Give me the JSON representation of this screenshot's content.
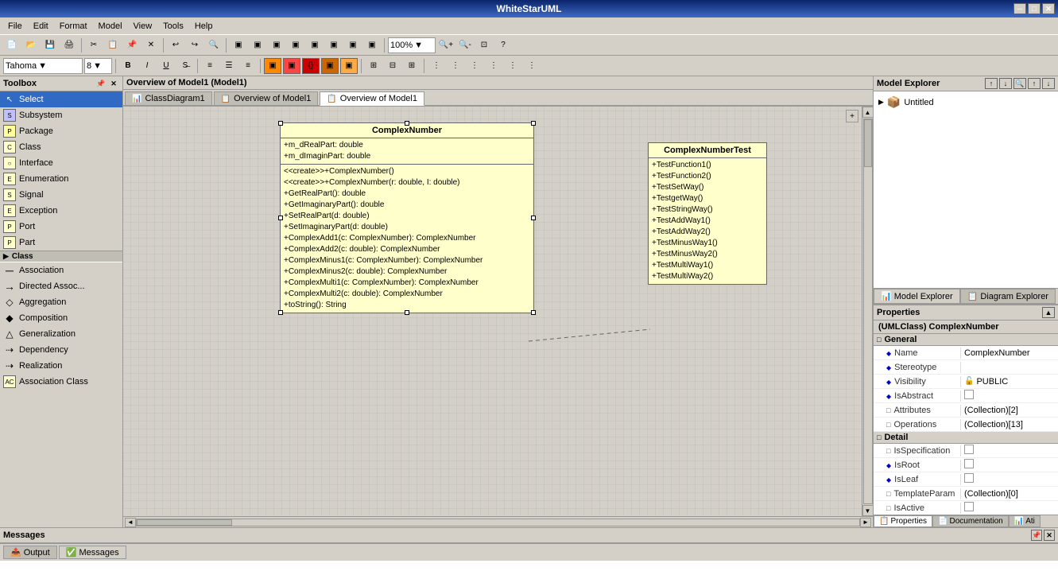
{
  "app": {
    "title": "WhiteStarUML",
    "min_btn": "─",
    "max_btn": "□",
    "close_btn": "✕"
  },
  "menu": {
    "items": [
      "File",
      "Edit",
      "Format",
      "Model",
      "View",
      "Tools",
      "Help"
    ]
  },
  "toolbar1": {
    "zoom_value": "100%",
    "font_name": "Tahoma",
    "font_size": "8"
  },
  "toolbox": {
    "title": "Toolbox",
    "sections": {
      "class_label": "Class"
    },
    "items": [
      {
        "id": "select",
        "label": "Select",
        "icon": "↖"
      },
      {
        "id": "subsystem",
        "label": "Subsystem",
        "icon": "▣"
      },
      {
        "id": "package",
        "label": "Package",
        "icon": "▱"
      },
      {
        "id": "class",
        "label": "Class",
        "icon": "▣"
      },
      {
        "id": "interface",
        "label": "Interface",
        "icon": "◎"
      },
      {
        "id": "enumeration",
        "label": "Enumeration",
        "icon": "▣"
      },
      {
        "id": "signal",
        "label": "Signal",
        "icon": "▣"
      },
      {
        "id": "exception",
        "label": "Exception",
        "icon": "▣"
      },
      {
        "id": "port",
        "label": "Port",
        "icon": "▣"
      },
      {
        "id": "part",
        "label": "Part",
        "icon": "▣"
      },
      {
        "id": "association",
        "label": "Association",
        "icon": "─"
      },
      {
        "id": "directed-assoc",
        "label": "Directed Assoc...",
        "icon": "→"
      },
      {
        "id": "aggregation",
        "label": "Aggregation",
        "icon": "◇"
      },
      {
        "id": "composition",
        "label": "Composition",
        "icon": "◆"
      },
      {
        "id": "generalization",
        "label": "Generalization",
        "icon": "△"
      },
      {
        "id": "dependency",
        "label": "Dependency",
        "icon": "⇢"
      },
      {
        "id": "realization",
        "label": "Realization",
        "icon": "⇢"
      },
      {
        "id": "association-class",
        "label": "Association Class",
        "icon": "▣"
      }
    ]
  },
  "tabs": {
    "items": [
      {
        "id": "class-diagram",
        "label": "ClassDiagram1",
        "icon": "📊",
        "active": false
      },
      {
        "id": "overview-model1-tab",
        "label": "Overview of Model1",
        "icon": "📋",
        "active": false
      },
      {
        "id": "overview-model1",
        "label": "Overview of Model1",
        "icon": "📋",
        "active": true
      }
    ],
    "header": "Overview of Model1 (Model1)"
  },
  "diagram": {
    "complex_number": {
      "title": "ComplexNumber",
      "attributes": [
        "+m_dRealPart: double",
        "+m_dImaginPart: double"
      ],
      "operations": [
        "<<create>>+ComplexNumber()",
        "<<create>>+ComplexNumber(r: double, I: double)",
        "+GetRealPart(): double",
        "+GetImaginaryPart(): double",
        "+SetRealPart(d: double)",
        "+SetImaginaryPart(d: double)",
        "+ComplexAdd1(c: ComplexNumber): ComplexNumber",
        "+ComplexAdd2(c: double): ComplexNumber",
        "+ComplexMinus1(c: ComplexNumber): ComplexNumber",
        "+ComplexMinus2(c: double): ComplexNumber",
        "+ComplexMulti1(c: ComplexNumber): ComplexNumber",
        "+ComplexMulti2(c: double): ComplexNumber",
        "+toString(): String"
      ]
    },
    "complex_number_test": {
      "title": "ComplexNumberTest",
      "operations": [
        "+TestFunction1()",
        "+TestFunction2()",
        "+TestSetWay()",
        "+TestgetWay()",
        "+TestStringWay()",
        "+TestAddWay1()",
        "+TestAddWay2()",
        "+TestMinusWay1()",
        "+TestMinusWay2()",
        "+TestMultiWay1()",
        "+TestMultiWay2()"
      ]
    }
  },
  "model_explorer": {
    "title": "Model Explorer",
    "tabs": [
      {
        "id": "model-explorer-tab",
        "label": "Model Explorer",
        "active": true
      },
      {
        "id": "diagram-explorer-tab",
        "label": "Diagram Explorer",
        "active": false
      }
    ],
    "tree": {
      "root": "Untitled"
    }
  },
  "properties": {
    "title": "Properties",
    "object_title": "(UMLClass) ComplexNumber",
    "sections": {
      "general": "General",
      "detail": "Detail"
    },
    "general_props": [
      {
        "key": "Name",
        "val": "ComplexNumber",
        "type": "diamond"
      },
      {
        "key": "Stereotype",
        "val": "",
        "type": "diamond"
      },
      {
        "key": "Visibility",
        "val": "PUBLIC",
        "type": "diamond",
        "has_icon": true
      },
      {
        "key": "IsAbstract",
        "val": "",
        "type": "diamond",
        "has_checkbox": true
      },
      {
        "key": "Attributes",
        "val": "(Collection)[2]",
        "type": "square"
      },
      {
        "key": "Operations",
        "val": "(Collection)[13]",
        "type": "square"
      }
    ],
    "detail_props": [
      {
        "key": "IsSpecification",
        "val": "",
        "type": "square",
        "has_checkbox": true
      },
      {
        "key": "IsRoot",
        "val": "",
        "type": "diamond",
        "has_checkbox": true
      },
      {
        "key": "IsLeaf",
        "val": "",
        "type": "diamond",
        "has_checkbox": true
      },
      {
        "key": "TemplateParam",
        "val": "(Collection)[0]",
        "type": "square"
      },
      {
        "key": "IsActive",
        "val": "",
        "type": "square",
        "has_checkbox": true
      }
    ],
    "bottom_tabs": [
      {
        "id": "properties-tab",
        "label": "Properties",
        "active": true
      },
      {
        "id": "documentation-tab",
        "label": "Documentation",
        "active": false
      },
      {
        "id": "ati-tab",
        "label": "Ati",
        "active": false
      }
    ]
  },
  "messages": {
    "title": "Messages"
  },
  "bottom_tabs": [
    {
      "id": "output-tab",
      "label": "Output",
      "active": false
    },
    {
      "id": "messages-tab",
      "label": "Messages",
      "active": true
    }
  ]
}
